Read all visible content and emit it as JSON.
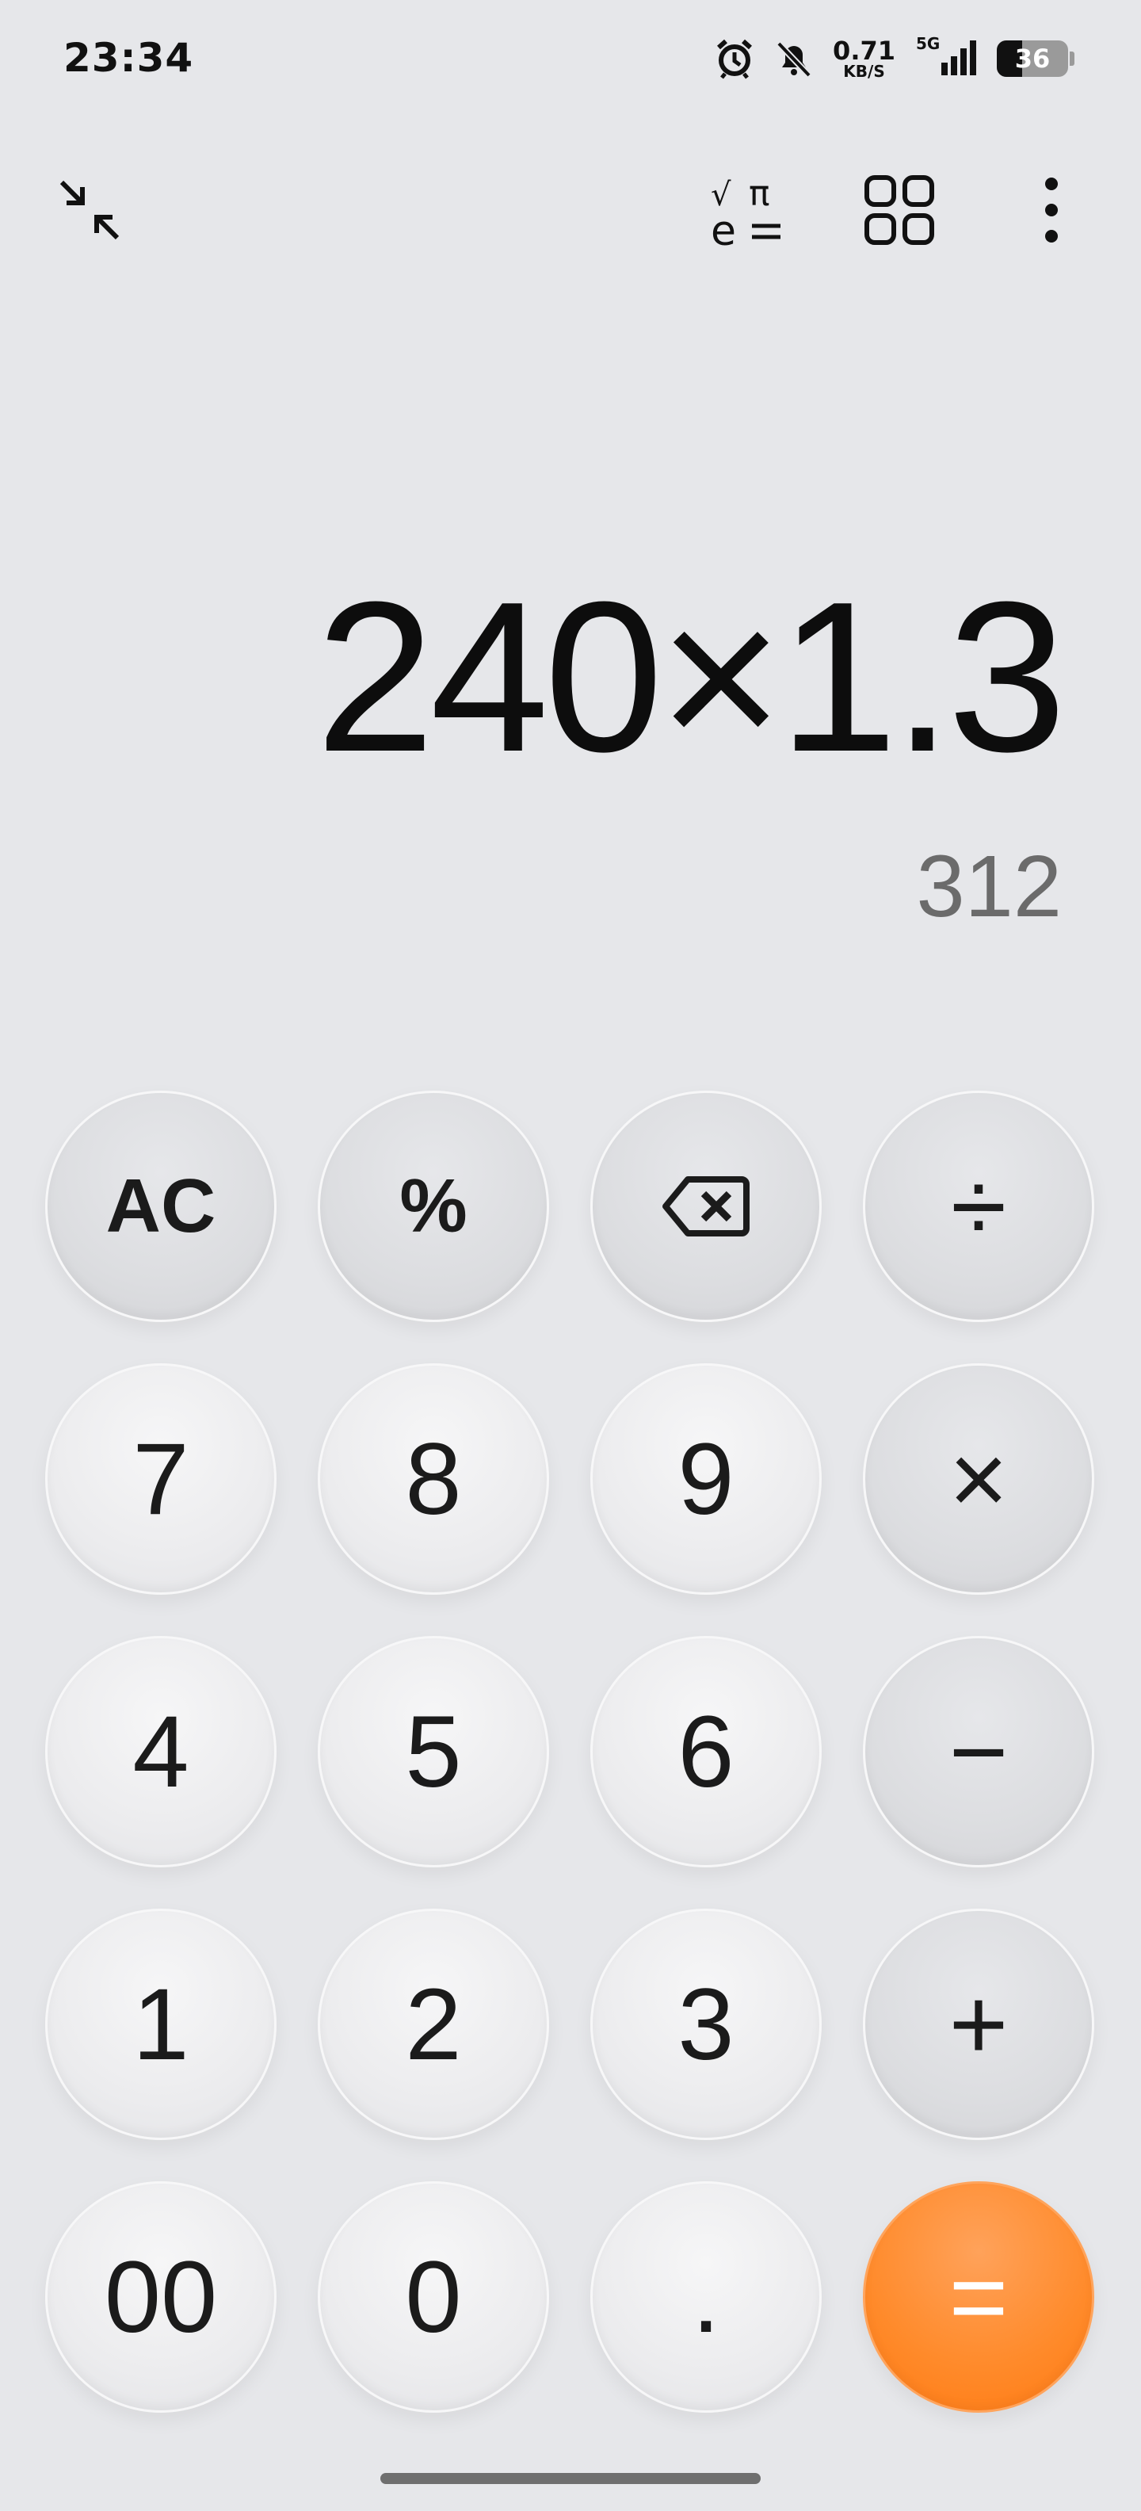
{
  "status_bar": {
    "time": "23:34",
    "net_speed_value": "0.71",
    "net_speed_unit": "KB/S",
    "network_type": "5G",
    "battery": "36",
    "icons": [
      "alarm-icon",
      "bell-muted-icon",
      "signal-icon",
      "battery-icon"
    ]
  },
  "toolbar": {
    "icons": [
      "collapse-icon",
      "scientific-functions-icon",
      "converter-grid-icon",
      "more-options-icon"
    ]
  },
  "display": {
    "expression": "240×1.3",
    "result": "312"
  },
  "keypad": {
    "keys": [
      {
        "label": "AC",
        "role": "clear"
      },
      {
        "label": "%",
        "role": "percent"
      },
      {
        "label": "",
        "role": "backspace",
        "icon": "backspace-icon"
      },
      {
        "label": "÷",
        "role": "divide"
      },
      {
        "label": "7"
      },
      {
        "label": "8"
      },
      {
        "label": "9"
      },
      {
        "label": "×",
        "role": "multiply"
      },
      {
        "label": "4"
      },
      {
        "label": "5"
      },
      {
        "label": "6"
      },
      {
        "label": "−",
        "role": "subtract"
      },
      {
        "label": "1"
      },
      {
        "label": "2"
      },
      {
        "label": "3"
      },
      {
        "label": "+",
        "role": "add"
      },
      {
        "label": "00"
      },
      {
        "label": "0"
      },
      {
        "label": "."
      },
      {
        "label": "=",
        "role": "equals"
      }
    ]
  },
  "colors": {
    "background": "#e6e7ea",
    "equals_accent": "#ff8a2a",
    "result_text": "#6b6b6b"
  }
}
